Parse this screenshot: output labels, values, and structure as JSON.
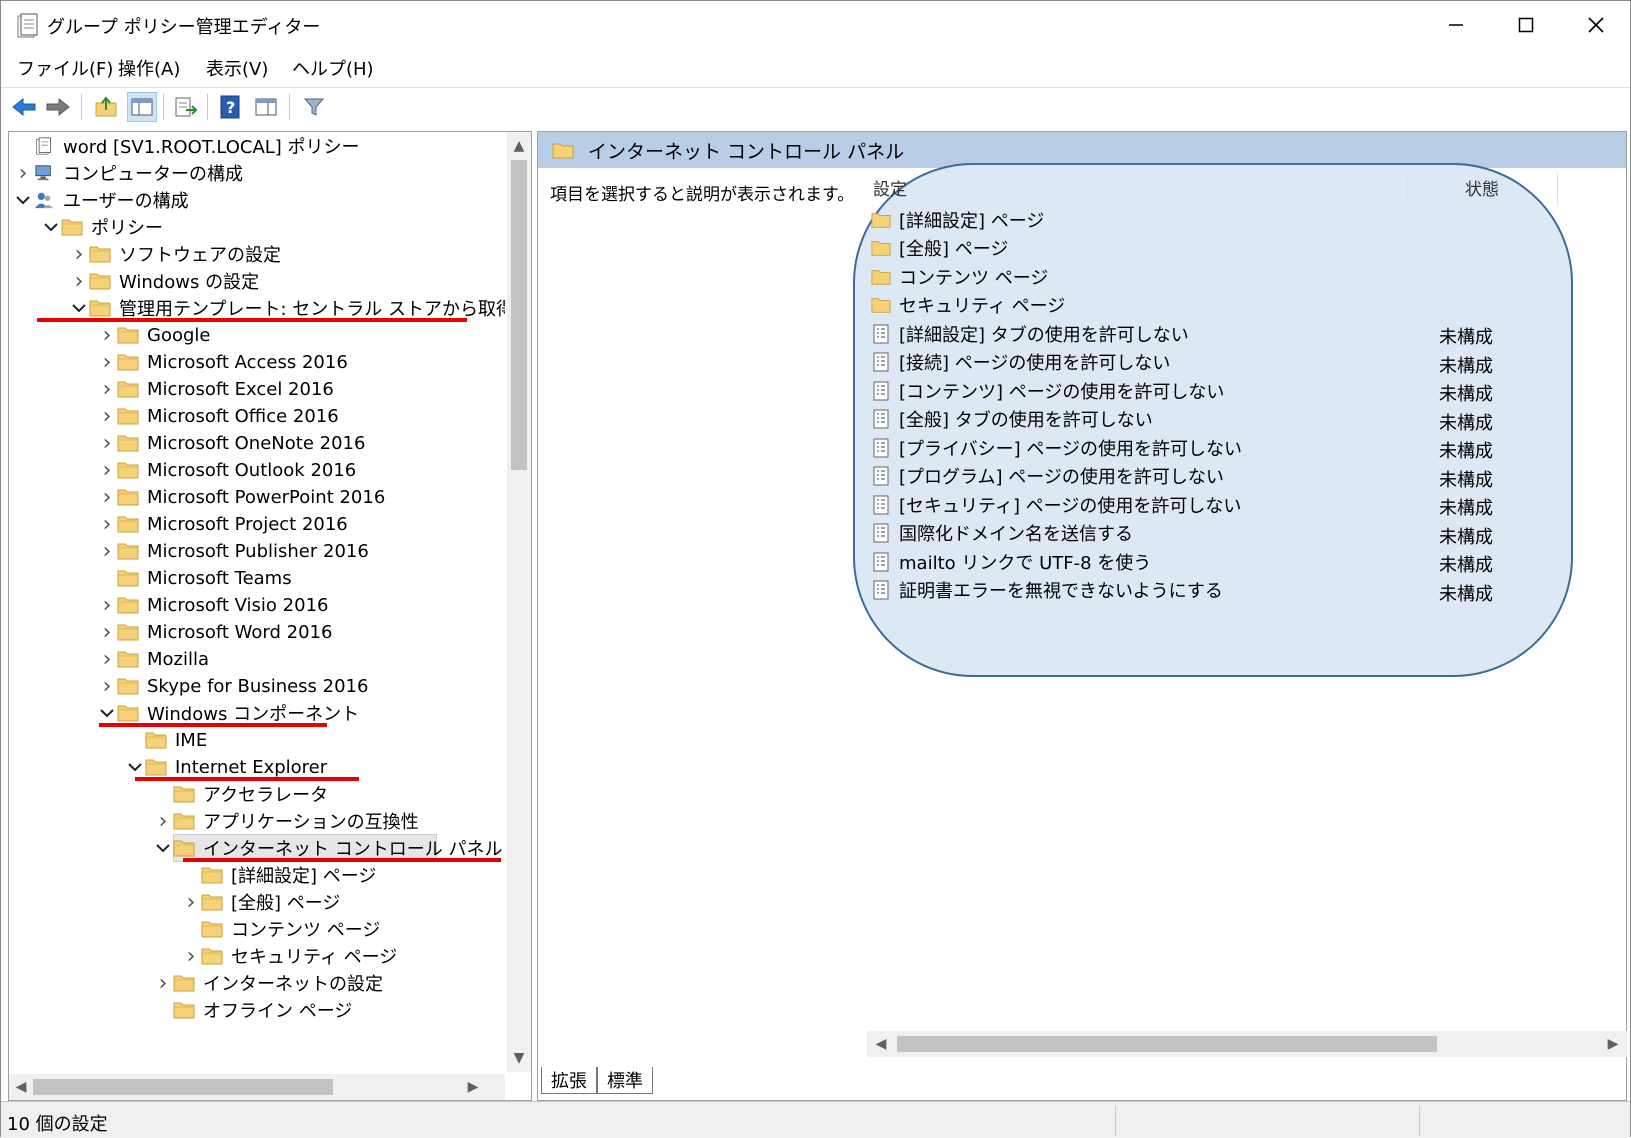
{
  "window": {
    "title": "グループ ポリシー管理エディター",
    "minimize": "—",
    "maximize": "☐",
    "close": "✕"
  },
  "menus": [
    "ファイル(F)",
    "操作(A)",
    "表示(V)",
    "ヘルプ(H)"
  ],
  "toolbar": {
    "icons": [
      "back-arrow-icon",
      "forward-arrow-icon",
      "up-folder-icon",
      "show-tree-icon",
      "export-list-icon",
      "help-icon",
      "properties-icon",
      "filter-icon"
    ]
  },
  "tree": {
    "root": "word [SV1.ROOT.LOCAL] ポリシー",
    "computer_config": "コンピューターの構成",
    "user_config": "ユーザーの構成",
    "policies": "ポリシー",
    "software_settings": "ソフトウェアの設定",
    "windows_settings": "Windows の設定",
    "admin_templates": "管理用テンプレート: セントラル ストアから取得したポ",
    "google": "Google",
    "access": "Microsoft Access 2016",
    "excel": "Microsoft Excel 2016",
    "office": "Microsoft Office 2016",
    "onenote": "Microsoft OneNote 2016",
    "outlook": "Microsoft Outlook 2016",
    "powerpoint": "Microsoft PowerPoint 2016",
    "project": "Microsoft Project 2016",
    "publisher": "Microsoft Publisher 2016",
    "teams": "Microsoft Teams",
    "visio": "Microsoft Visio 2016",
    "word": "Microsoft Word 2016",
    "mozilla": "Mozilla",
    "skype": "Skype for Business 2016",
    "windows_components": "Windows コンポーネント",
    "ime": "IME",
    "ie": "Internet Explorer",
    "accelerator": "アクセラレータ",
    "app_compat": "アプリケーションの互換性",
    "icp": "インターネット コントロール パネル",
    "advanced_page": "[詳細設定] ページ",
    "general_page": "[全般] ページ",
    "content_page": "コンテンツ ページ",
    "security_page": "セキュリティ ページ",
    "internet_settings": "インターネットの設定",
    "offline_page": "オフライン ページ"
  },
  "right": {
    "header": "インターネット コントロール パネル",
    "description": "項目を選択すると説明が表示されます。",
    "col_setting": "設定",
    "col_state": "状態",
    "rows": [
      {
        "name": "[詳細設定] ページ",
        "state": "",
        "type": "folder"
      },
      {
        "name": "[全般] ページ",
        "state": "",
        "type": "folder"
      },
      {
        "name": "コンテンツ ページ",
        "state": "",
        "type": "folder"
      },
      {
        "name": "セキュリティ ページ",
        "state": "",
        "type": "folder"
      },
      {
        "name": "[詳細設定] タブの使用を許可しない",
        "state": "未構成",
        "type": "policy"
      },
      {
        "name": "[接続] ページの使用を許可しない",
        "state": "未構成",
        "type": "policy"
      },
      {
        "name": "[コンテンツ] ページの使用を許可しない",
        "state": "未構成",
        "type": "policy"
      },
      {
        "name": "[全般] タブの使用を許可しない",
        "state": "未構成",
        "type": "policy"
      },
      {
        "name": "[プライバシー] ページの使用を許可しない",
        "state": "未構成",
        "type": "policy"
      },
      {
        "name": "[プログラム] ページの使用を許可しない",
        "state": "未構成",
        "type": "policy"
      },
      {
        "name": "[セキュリティ] ページの使用を許可しない",
        "state": "未構成",
        "type": "policy"
      },
      {
        "name": "国際化ドメイン名を送信する",
        "state": "未構成",
        "type": "policy"
      },
      {
        "name": "mailto リンクで UTF-8 を使う",
        "state": "未構成",
        "type": "policy"
      },
      {
        "name": "証明書エラーを無視できないようにする",
        "state": "未構成",
        "type": "policy"
      }
    ]
  },
  "tabs": [
    "拡張",
    "標準"
  ],
  "status": "10 個の設定",
  "colors": {
    "header_bg": "#b8cde6",
    "highlight_red": "#e60000",
    "bubble_fill": "#dce8f3",
    "bubble_border": "#3d6b9a",
    "folder_yellow": "#f5d279"
  }
}
